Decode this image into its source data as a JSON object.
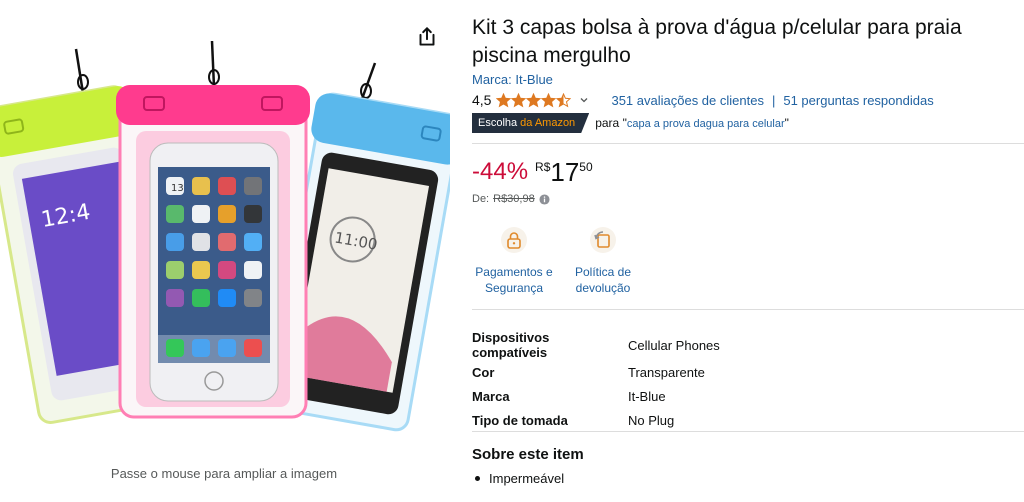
{
  "gallery": {
    "hover_hint": "Passe o mouse para ampliar a imagem",
    "share_icon": "share-icon",
    "phone_pouches": [
      {
        "color": "#c8f03a",
        "screen_text": "12:4"
      },
      {
        "color": "#5ab8ec",
        "screen_text": "11:00"
      },
      {
        "color": "#ff3b8e",
        "app_icon_label": "13"
      }
    ]
  },
  "product": {
    "title": "Kit 3 capas bolsa à prova d'água p/celular para praia piscina mergulho",
    "brand_link": "Marca: It-Blue",
    "rating_value": "4,5",
    "rating_stars": 4.5,
    "ratings_count": "351 avaliações de clientes",
    "separator": "|",
    "questions": "51 perguntas respondidas",
    "choice_badge": {
      "prefix": "Escolha",
      "suffix": "da Amazon"
    },
    "choice_for": "para",
    "choice_query_open": "\"",
    "choice_query": "capa a prova dagua para celular",
    "choice_query_close": "\"",
    "price": {
      "discount": "-44%",
      "currency": "R$",
      "whole": "17",
      "fraction": "50",
      "list_label": "De:",
      "list_price": "R$30,98"
    },
    "features": [
      {
        "icon": "secure-payment-icon",
        "line1": "Pagamentos e",
        "line2": "Segurança"
      },
      {
        "icon": "return-policy-icon",
        "line1": "Política de",
        "line2": "devolução"
      }
    ],
    "specs": [
      {
        "key": "Dispositivos compatíveis",
        "value": "Cellular Phones"
      },
      {
        "key": "Cor",
        "value": "Transparente"
      },
      {
        "key": "Marca",
        "value": "It-Blue"
      },
      {
        "key": "Tipo de tomada",
        "value": "No Plug"
      }
    ],
    "about_title": "Sobre este item",
    "about_bullets": [
      "Impermeável"
    ]
  },
  "colors": {
    "link": "#2162a1",
    "discount": "#cc0c39",
    "star": "#de7921",
    "badge_bg": "#232f3e",
    "badge_accent": "#ff9900"
  }
}
